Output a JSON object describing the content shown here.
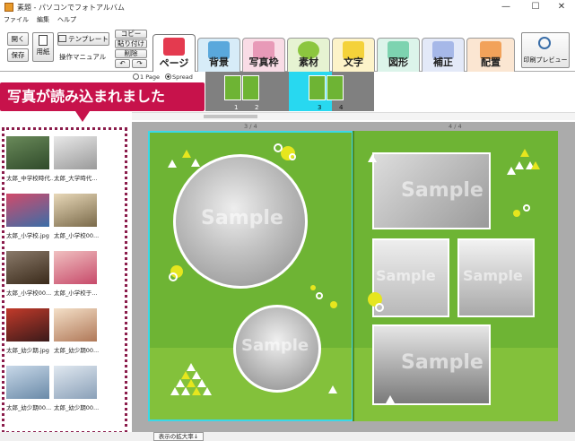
{
  "window": {
    "title": "素題 - パソコンでフォトアルバム",
    "controls": [
      "—",
      "☐",
      "✕"
    ]
  },
  "menu": [
    "ファイル",
    "編集",
    "ヘルプ"
  ],
  "toolbar": {
    "open": "開く",
    "save": "保存",
    "paper": "用紙",
    "template": "テンプレート",
    "manual": "操作マニュアル",
    "copy": "コピー",
    "paste": "貼り付け",
    "delete": "削除",
    "undo": "↶",
    "redo": "↷",
    "tabs": [
      {
        "key": "page",
        "label": "ページ",
        "color": "#e43a4f",
        "active": true
      },
      {
        "key": "background",
        "label": "背景",
        "color": "#5aa8dc"
      },
      {
        "key": "frame",
        "label": "写真枠",
        "color": "#e89ab8"
      },
      {
        "key": "material",
        "label": "素材",
        "color": "#8cc63f"
      },
      {
        "key": "text",
        "label": "文字",
        "color": "#f4d23a"
      },
      {
        "key": "shape",
        "label": "図形",
        "color": "#7dd3b0"
      },
      {
        "key": "correct",
        "label": "補正",
        "color": "#a6b8e8"
      },
      {
        "key": "layout",
        "label": "配置",
        "color": "#f2a25a"
      }
    ],
    "print_preview": "印刷プレビュー"
  },
  "strip": {
    "radio_single": "1 Page",
    "radio_spread": "Spread",
    "thumbs": [
      {
        "pages": [
          "1",
          "2"
        ],
        "selected": false
      },
      {
        "pages": [
          "3",
          "4"
        ],
        "selected": true
      }
    ]
  },
  "callout": "写真が読み込まれました",
  "photos": [
    {
      "name": "太郎_中学校時代..."
    },
    {
      "name": "太郎_大学時代..."
    },
    {
      "name": "太郎_小学校.jpg"
    },
    {
      "name": "太郎_小学校00..."
    },
    {
      "name": "太郎_小学校00..."
    },
    {
      "name": "太郎_小学校于..."
    },
    {
      "name": "太郎_幼少期.jpg"
    },
    {
      "name": "太郎_幼少期00..."
    },
    {
      "name": "太郎_幼少期00..."
    },
    {
      "name": "太郎_幼少期00..."
    }
  ],
  "spread": {
    "left_label": "3 / 4",
    "right_label": "4 / 4",
    "watermark": "Sample"
  },
  "status": {
    "zoom_button": "表示の拡大率↓"
  }
}
